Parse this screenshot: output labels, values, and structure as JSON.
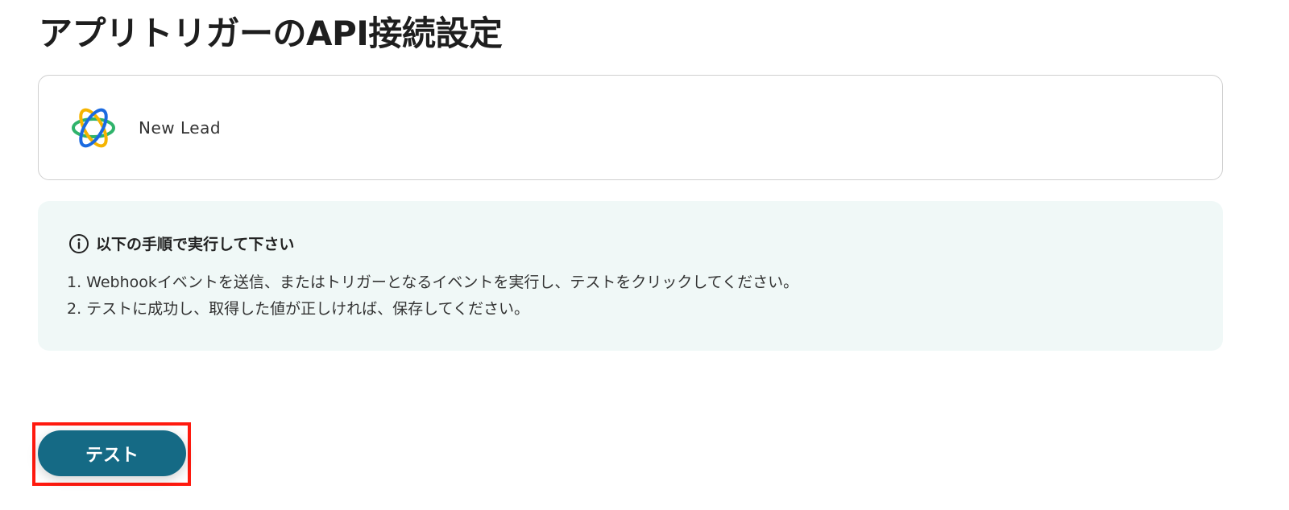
{
  "page_title": "アプリトリガーのAPI接続設定",
  "trigger": {
    "icon": "app-logo-icon",
    "name": "New Lead"
  },
  "instructions": {
    "icon": "info-icon",
    "title": "以下の手順で実行して下さい",
    "steps": [
      "1. Webhookイベントを送信、またはトリガーとなるイベントを実行し、テストをクリックしてください。",
      "2. テストに成功し、取得した値が正しければ、保存してください。"
    ]
  },
  "actions": {
    "test_label": "テスト"
  },
  "colors": {
    "primary_button": "#156a85",
    "instructions_background": "#f0f8f7",
    "highlight_border": "#ff1a0f"
  }
}
